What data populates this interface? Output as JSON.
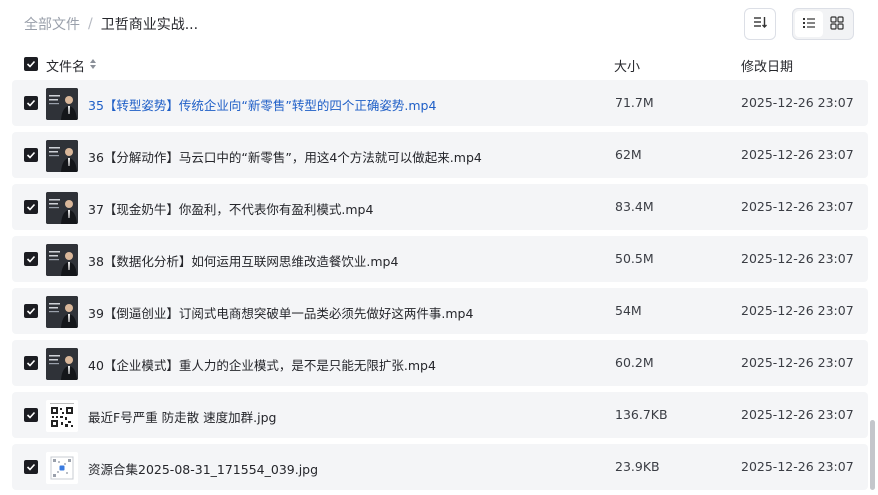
{
  "breadcrumb": {
    "root": "全部文件",
    "separator": "/",
    "current": "卫哲商业实战..."
  },
  "toolbar": {
    "sort_icon": "sort-list-icon",
    "list_icon": "list-view-icon",
    "grid_icon": "grid-view-icon"
  },
  "header": {
    "name": "文件名",
    "size": "大小",
    "date": "修改日期"
  },
  "rows": [
    {
      "name": "35【转型姿势】传统企业向“新零售”转型的四个正确姿势.mp4",
      "size": "71.7M",
      "date": "2025-12-26 23:07",
      "type": "video",
      "highlight": true
    },
    {
      "name": "36【分解动作】马云口中的“新零售”，用这4个方法就可以做起来.mp4",
      "size": "62M",
      "date": "2025-12-26 23:07",
      "type": "video"
    },
    {
      "name": "37【现金奶牛】你盈利，不代表你有盈利模式.mp4",
      "size": "83.4M",
      "date": "2025-12-26 23:07",
      "type": "video"
    },
    {
      "name": "38【数据化分析】如何运用互联网思维改造餐饮业.mp4",
      "size": "50.5M",
      "date": "2025-12-26 23:07",
      "type": "video"
    },
    {
      "name": "39【倒逼创业】订阅式电商想突破单一品类必须先做好这两件事.mp4",
      "size": "54M",
      "date": "2025-12-26 23:07",
      "type": "video"
    },
    {
      "name": "40【企业模式】重人力的企业模式，是不是只能无限扩张.mp4",
      "size": "60.2M",
      "date": "2025-12-26 23:07",
      "type": "video"
    },
    {
      "name": "最近F号严重 防走散 速度加群.jpg",
      "size": "136.7KB",
      "date": "2025-12-26 23:07",
      "type": "qr"
    },
    {
      "name": "资源合集2025-08-31_171554_039.jpg",
      "size": "23.9KB",
      "date": "2025-12-26 23:07",
      "type": "qr2"
    }
  ]
}
